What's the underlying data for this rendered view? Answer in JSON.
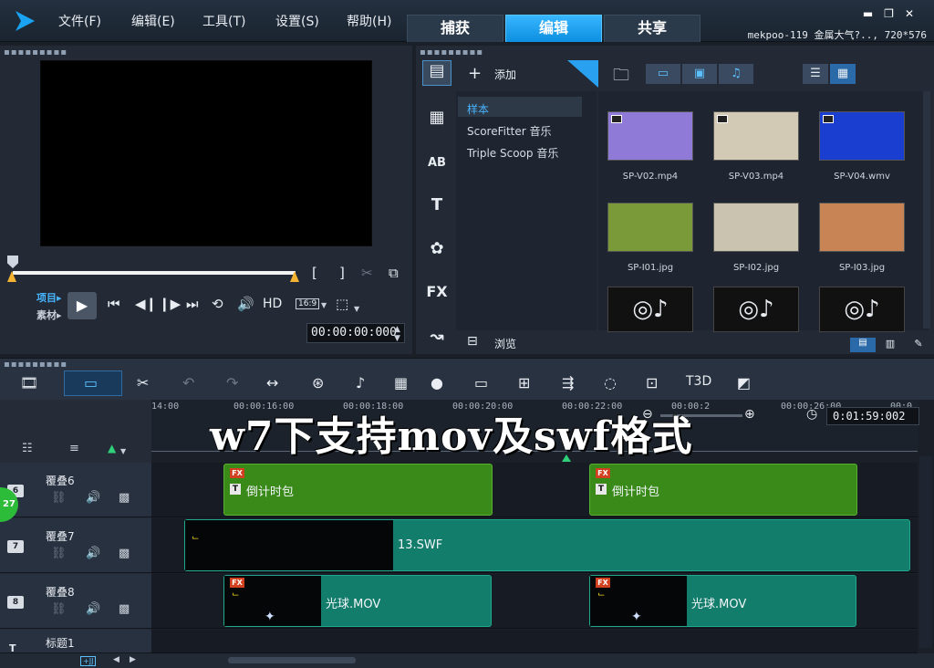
{
  "menu": [
    "文件(F)",
    "编辑(E)",
    "工具(T)",
    "设置(S)",
    "帮助(H)"
  ],
  "mode_tabs": [
    "捕获",
    "编辑",
    "共享"
  ],
  "project_info": "mekpoo-119 金属大气?.., 720*576",
  "player": {
    "mode_project": "项目▸",
    "mode_clip": "素材▸",
    "hd_label": "HD",
    "aspect_label": "16:9",
    "timecode": "00:00:00:000"
  },
  "library": {
    "add_label": "添加",
    "browse_label": "浏览",
    "folders": [
      "样本",
      "ScoreFitter 音乐",
      "Triple Scoop 音乐"
    ],
    "media": [
      {
        "name": "SP-V02.mp4",
        "kind": "video",
        "color": "#8f7ad8"
      },
      {
        "name": "SP-V03.mp4",
        "kind": "video",
        "color": "#d2cab4"
      },
      {
        "name": "SP-V04.wmv",
        "kind": "video",
        "color": "#1a3fd0"
      },
      {
        "name": "SP-I01.jpg",
        "kind": "image",
        "color": "#7a9a3a"
      },
      {
        "name": "SP-I02.jpg",
        "kind": "image",
        "color": "#c9c3b0"
      },
      {
        "name": "SP-I03.jpg",
        "kind": "image",
        "color": "#c98456"
      },
      {
        "name": "",
        "kind": "audio",
        "color": "#111111"
      },
      {
        "name": "",
        "kind": "audio",
        "color": "#111111"
      },
      {
        "name": "",
        "kind": "audio",
        "color": "#111111"
      }
    ]
  },
  "timeline": {
    "ruler_ticks": [
      "14:00",
      "00:00:16:00",
      "00:00:18:00",
      "00:00:20:00",
      "00:00:22:00",
      "00:00:2",
      "00:00:26:00",
      "00:0"
    ],
    "timecode": "0:01:59:002",
    "overlay_caption": "w7下支持mov及swf格式",
    "badge": "27",
    "tracks": [
      {
        "name": "覆叠6",
        "num": "6"
      },
      {
        "name": "覆叠7",
        "num": "7"
      },
      {
        "name": "覆叠8",
        "num": "8"
      },
      {
        "name": "标题1",
        "num": "T"
      }
    ],
    "clips": {
      "countdown_a": "倒计时包",
      "countdown_b": "倒计时包",
      "swf": "13.SWF",
      "mov_a": "光球.MOV",
      "mov_b": "光球.MOV",
      "fx": "FX",
      "t": "T"
    }
  },
  "colors": {
    "accent": "#1aa3f2",
    "clip_green": "#3a8a1a",
    "clip_teal": "#127d6a"
  }
}
